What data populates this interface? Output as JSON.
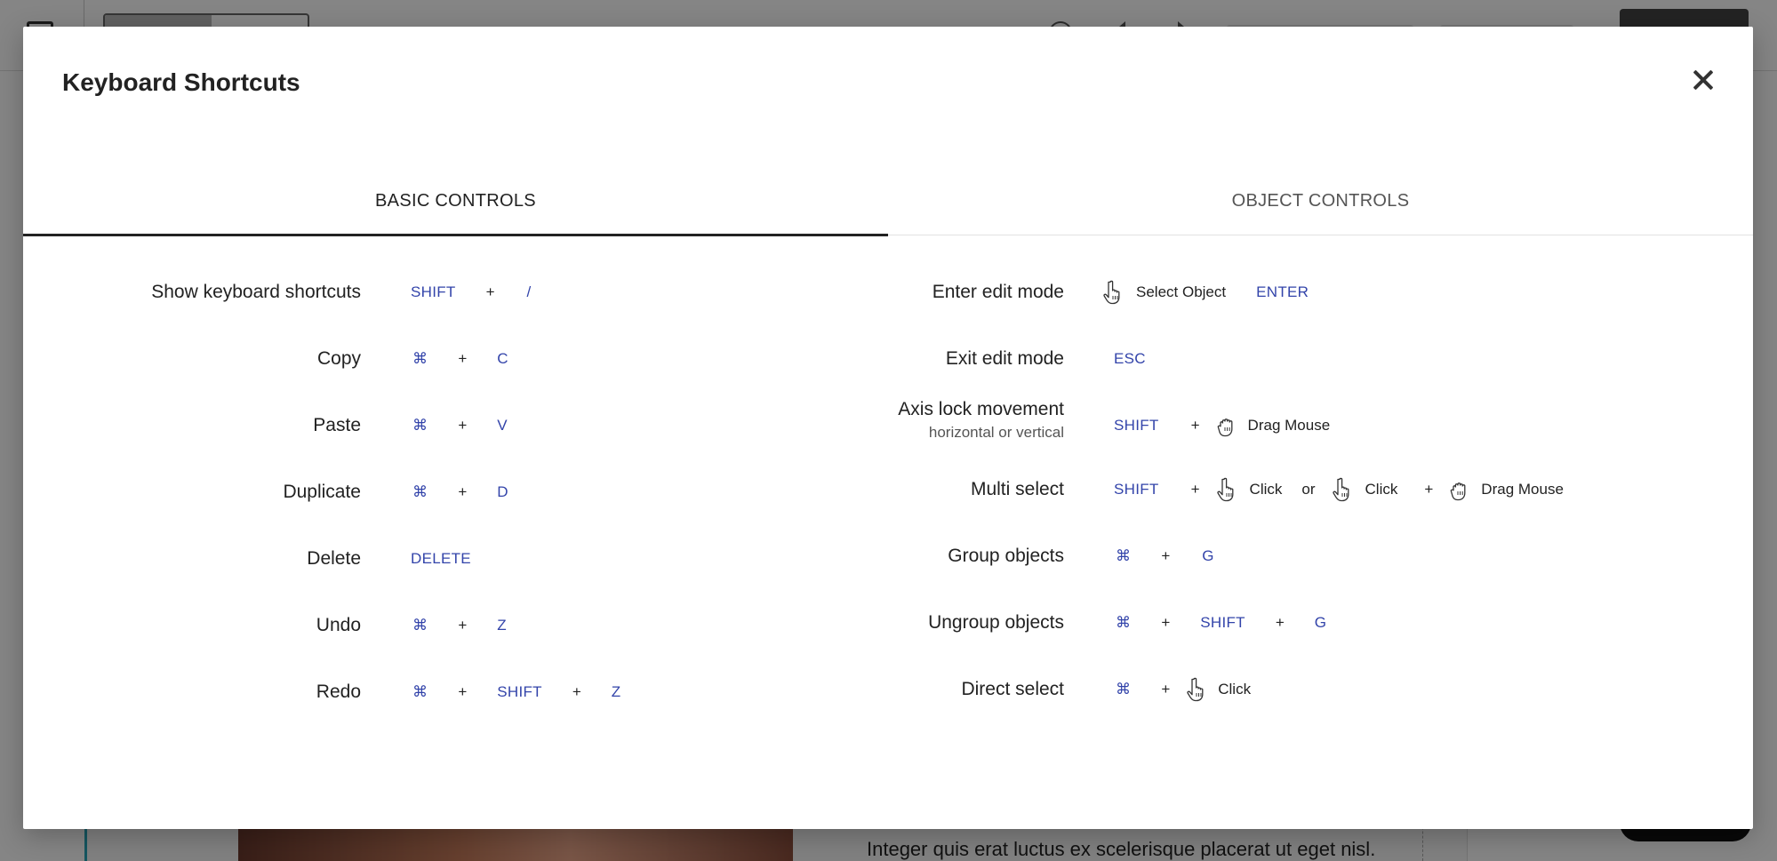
{
  "background": {
    "body_text": "Integer quis erat luctus ex scelerisque placerat ut eget nisl."
  },
  "modal": {
    "title": "Keyboard Shortcuts",
    "close_icon": "close-icon",
    "tabs": [
      {
        "label": "BASIC CONTROLS",
        "active": true
      },
      {
        "label": "OBJECT CONTROLS",
        "active": false
      }
    ],
    "basic_controls": [
      {
        "label": "Show keyboard shortcuts",
        "keys": [
          "SHIFT",
          "+",
          "/"
        ]
      },
      {
        "label": "Copy",
        "keys": [
          "⌘",
          "+",
          "C"
        ]
      },
      {
        "label": "Paste",
        "keys": [
          "⌘",
          "+",
          "V"
        ]
      },
      {
        "label": "Duplicate",
        "keys": [
          "⌘",
          "+",
          "D"
        ]
      },
      {
        "label": "Delete",
        "keys": [
          "DELETE"
        ]
      },
      {
        "label": "Undo",
        "keys": [
          "⌘",
          "+",
          "Z"
        ]
      },
      {
        "label": "Redo",
        "keys": [
          "⌘",
          "+",
          "SHIFT",
          "+",
          "Z"
        ]
      }
    ],
    "object_controls": [
      {
        "label": "Enter edit mode",
        "parts": {
          "action": "Select Object",
          "key": "ENTER"
        }
      },
      {
        "label": "Exit edit mode",
        "parts": {
          "key": "ESC"
        }
      },
      {
        "label": "Axis lock movement",
        "sublabel": "horizontal or vertical",
        "parts": {
          "key": "SHIFT",
          "plus": "+",
          "action": "Drag Mouse"
        }
      },
      {
        "label": "Multi select",
        "parts": {
          "key": "SHIFT",
          "plus": "+",
          "action1": "Click",
          "or": "or",
          "action2": "Click",
          "plus2": "+",
          "action3": "Drag Mouse"
        }
      },
      {
        "label": "Group objects",
        "parts": {
          "key1": "⌘",
          "plus": "+",
          "key2": "G"
        }
      },
      {
        "label": "Ungroup objects",
        "parts": {
          "key1": "⌘",
          "plus": "+",
          "key2": "SHIFT",
          "plus2": "+",
          "key3": "G"
        }
      },
      {
        "label": "Direct select",
        "parts": {
          "key1": "⌘",
          "plus": "+",
          "action": "Click"
        }
      }
    ],
    "colors": {
      "key": "#3344aa",
      "text": "#222222",
      "overlay": "rgba(0,0,0,0.48)"
    },
    "icons": {
      "pointer": "hand-pointer-icon",
      "drag": "hand-grab-icon"
    }
  }
}
